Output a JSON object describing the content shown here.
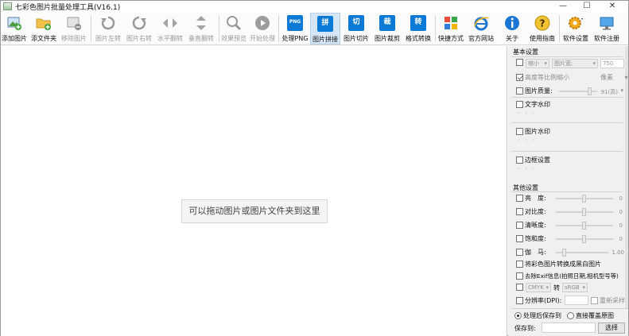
{
  "window": {
    "title": "七彩色图片批量处理工具(V16.1)",
    "controls": {
      "minimize": "—",
      "maximize": "☐",
      "close": "✕"
    }
  },
  "toolbar": {
    "add_image": "添加图片",
    "add_folder": "添文件夹",
    "remove_image": "移除图片",
    "rotate_left": "图片左转",
    "rotate_right": "图片右转",
    "flip_h": "水平翻转",
    "flip_v": "垂直翻转",
    "preview": "效果预览",
    "start": "开始处理",
    "png_proc": "处理PNG",
    "png_badge": "PNG",
    "stitch": "图片拼接",
    "stitch_badge": "拼",
    "slice": "图片切片",
    "slice_badge": "切",
    "crop": "图片裁剪",
    "crop_badge": "裁",
    "convert": "格式转换",
    "convert_badge": "转",
    "shortcut": "快捷方式",
    "website": "官方网站",
    "about": "关于",
    "guide": "使用指南",
    "settings": "软件设置",
    "register": "软件注册"
  },
  "main": {
    "drop_hint": "可以拖动图片或图片文件夹到这里"
  },
  "panel": {
    "basic_title": "基本设置",
    "scale_select": "缩小",
    "width_select": "图片宽:",
    "width_value": "750",
    "keep_ratio": "高度等比例缩小",
    "unit_select": "像素",
    "quality_label": "图片质量:",
    "quality_value": "91(高)",
    "text_watermark": "文字水印",
    "image_watermark": "图片水印",
    "border_setting": "边框设置",
    "dots": "· · ·",
    "other_title": "其他设置",
    "brightness": "亮　度:",
    "contrast": "对比度:",
    "sharpness": "清晰度:",
    "saturation": "饱和度:",
    "gamma": "伽　马:",
    "slider_zero": "0",
    "gamma_value": "1.00",
    "to_bw": "将彩色图片转换成黑白图片",
    "remove_exif": "去除Exif信息(拍照日期,相机型号等)",
    "cmyk": "CMYK",
    "to_label": "转",
    "srgb": "sRGB",
    "dpi_label": "分辨率(DPI):",
    "resample": "重新采样",
    "save_after": "处理后保存到",
    "overwrite": "直接覆盖原图",
    "save_to": "保存到:",
    "choose_btn": "选择"
  }
}
